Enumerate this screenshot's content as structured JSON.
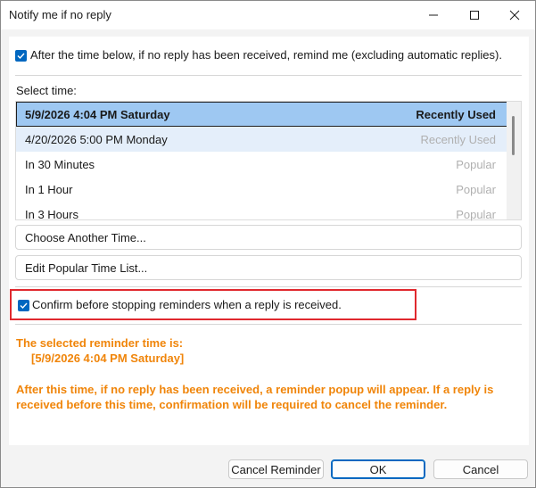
{
  "window": {
    "title": "Notify me if no reply",
    "controls": {
      "minimize": "minimize-icon",
      "maximize": "maximize-icon",
      "close": "close-icon"
    }
  },
  "top_option": {
    "checked": true,
    "label": "After the time below, if no reply has been received, remind me (excluding automatic replies)."
  },
  "select_time": {
    "label": "Select time:",
    "items": [
      {
        "time": "5/9/2026 4:04 PM Saturday",
        "tag": "Recently Used",
        "selected": true
      },
      {
        "time": "4/20/2026 5:00 PM Monday",
        "tag": "Recently Used"
      },
      {
        "time": "In 30 Minutes",
        "tag": "Popular"
      },
      {
        "time": "In 1 Hour",
        "tag": "Popular"
      },
      {
        "time": "In 3 Hours",
        "tag": "Popular"
      }
    ]
  },
  "buttons": {
    "choose_another": "Choose Another Time...",
    "edit_popular": "Edit Popular Time List..."
  },
  "confirm_option": {
    "checked": true,
    "label": "Confirm before stopping reminders when a reply is received."
  },
  "info": {
    "heading": "The selected reminder time is:",
    "selected_value": "[5/9/2026 4:04 PM Saturday]",
    "line1": "After this time, if no reply has been received, a reminder popup will appear. If a reply is",
    "line2": "received before this time, confirmation will be required to cancel the reminder."
  },
  "footer": {
    "cancel_reminder": "Cancel Reminder",
    "ok": "OK",
    "cancel": "Cancel"
  },
  "colors": {
    "accent": "#0067c0",
    "selection": "#9ec8f2",
    "info_text": "#f0850a",
    "highlight_border": "#e0282e"
  }
}
